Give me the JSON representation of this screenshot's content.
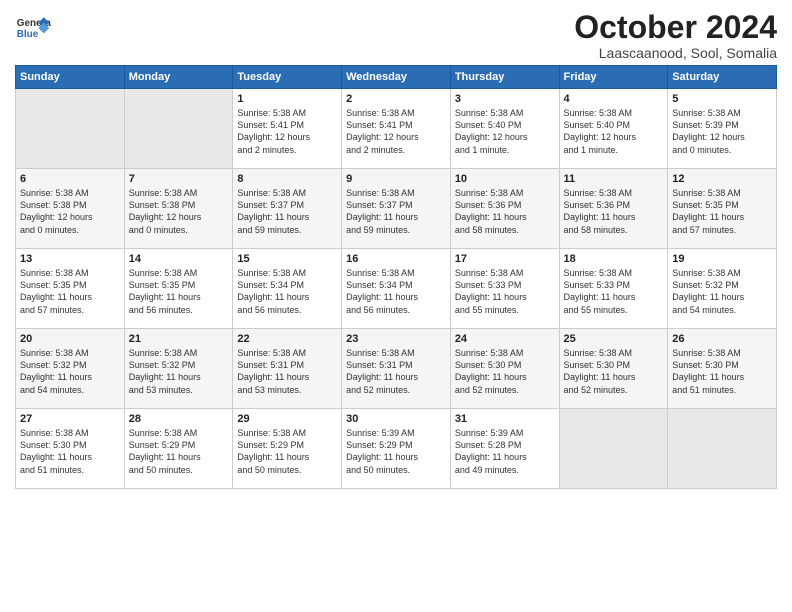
{
  "header": {
    "logo_line1": "General",
    "logo_line2": "Blue",
    "month": "October 2024",
    "location": "Laascaanood, Sool, Somalia"
  },
  "days_of_week": [
    "Sunday",
    "Monday",
    "Tuesday",
    "Wednesday",
    "Thursday",
    "Friday",
    "Saturday"
  ],
  "weeks": [
    [
      {
        "day": "",
        "content": ""
      },
      {
        "day": "",
        "content": ""
      },
      {
        "day": "1",
        "content": "Sunrise: 5:38 AM\nSunset: 5:41 PM\nDaylight: 12 hours\nand 2 minutes."
      },
      {
        "day": "2",
        "content": "Sunrise: 5:38 AM\nSunset: 5:41 PM\nDaylight: 12 hours\nand 2 minutes."
      },
      {
        "day": "3",
        "content": "Sunrise: 5:38 AM\nSunset: 5:40 PM\nDaylight: 12 hours\nand 1 minute."
      },
      {
        "day": "4",
        "content": "Sunrise: 5:38 AM\nSunset: 5:40 PM\nDaylight: 12 hours\nand 1 minute."
      },
      {
        "day": "5",
        "content": "Sunrise: 5:38 AM\nSunset: 5:39 PM\nDaylight: 12 hours\nand 0 minutes."
      }
    ],
    [
      {
        "day": "6",
        "content": "Sunrise: 5:38 AM\nSunset: 5:38 PM\nDaylight: 12 hours\nand 0 minutes."
      },
      {
        "day": "7",
        "content": "Sunrise: 5:38 AM\nSunset: 5:38 PM\nDaylight: 12 hours\nand 0 minutes."
      },
      {
        "day": "8",
        "content": "Sunrise: 5:38 AM\nSunset: 5:37 PM\nDaylight: 11 hours\nand 59 minutes."
      },
      {
        "day": "9",
        "content": "Sunrise: 5:38 AM\nSunset: 5:37 PM\nDaylight: 11 hours\nand 59 minutes."
      },
      {
        "day": "10",
        "content": "Sunrise: 5:38 AM\nSunset: 5:36 PM\nDaylight: 11 hours\nand 58 minutes."
      },
      {
        "day": "11",
        "content": "Sunrise: 5:38 AM\nSunset: 5:36 PM\nDaylight: 11 hours\nand 58 minutes."
      },
      {
        "day": "12",
        "content": "Sunrise: 5:38 AM\nSunset: 5:35 PM\nDaylight: 11 hours\nand 57 minutes."
      }
    ],
    [
      {
        "day": "13",
        "content": "Sunrise: 5:38 AM\nSunset: 5:35 PM\nDaylight: 11 hours\nand 57 minutes."
      },
      {
        "day": "14",
        "content": "Sunrise: 5:38 AM\nSunset: 5:35 PM\nDaylight: 11 hours\nand 56 minutes."
      },
      {
        "day": "15",
        "content": "Sunrise: 5:38 AM\nSunset: 5:34 PM\nDaylight: 11 hours\nand 56 minutes."
      },
      {
        "day": "16",
        "content": "Sunrise: 5:38 AM\nSunset: 5:34 PM\nDaylight: 11 hours\nand 56 minutes."
      },
      {
        "day": "17",
        "content": "Sunrise: 5:38 AM\nSunset: 5:33 PM\nDaylight: 11 hours\nand 55 minutes."
      },
      {
        "day": "18",
        "content": "Sunrise: 5:38 AM\nSunset: 5:33 PM\nDaylight: 11 hours\nand 55 minutes."
      },
      {
        "day": "19",
        "content": "Sunrise: 5:38 AM\nSunset: 5:32 PM\nDaylight: 11 hours\nand 54 minutes."
      }
    ],
    [
      {
        "day": "20",
        "content": "Sunrise: 5:38 AM\nSunset: 5:32 PM\nDaylight: 11 hours\nand 54 minutes."
      },
      {
        "day": "21",
        "content": "Sunrise: 5:38 AM\nSunset: 5:32 PM\nDaylight: 11 hours\nand 53 minutes."
      },
      {
        "day": "22",
        "content": "Sunrise: 5:38 AM\nSunset: 5:31 PM\nDaylight: 11 hours\nand 53 minutes."
      },
      {
        "day": "23",
        "content": "Sunrise: 5:38 AM\nSunset: 5:31 PM\nDaylight: 11 hours\nand 52 minutes."
      },
      {
        "day": "24",
        "content": "Sunrise: 5:38 AM\nSunset: 5:30 PM\nDaylight: 11 hours\nand 52 minutes."
      },
      {
        "day": "25",
        "content": "Sunrise: 5:38 AM\nSunset: 5:30 PM\nDaylight: 11 hours\nand 52 minutes."
      },
      {
        "day": "26",
        "content": "Sunrise: 5:38 AM\nSunset: 5:30 PM\nDaylight: 11 hours\nand 51 minutes."
      }
    ],
    [
      {
        "day": "27",
        "content": "Sunrise: 5:38 AM\nSunset: 5:30 PM\nDaylight: 11 hours\nand 51 minutes."
      },
      {
        "day": "28",
        "content": "Sunrise: 5:38 AM\nSunset: 5:29 PM\nDaylight: 11 hours\nand 50 minutes."
      },
      {
        "day": "29",
        "content": "Sunrise: 5:38 AM\nSunset: 5:29 PM\nDaylight: 11 hours\nand 50 minutes."
      },
      {
        "day": "30",
        "content": "Sunrise: 5:39 AM\nSunset: 5:29 PM\nDaylight: 11 hours\nand 50 minutes."
      },
      {
        "day": "31",
        "content": "Sunrise: 5:39 AM\nSunset: 5:28 PM\nDaylight: 11 hours\nand 49 minutes."
      },
      {
        "day": "",
        "content": ""
      },
      {
        "day": "",
        "content": ""
      }
    ]
  ]
}
